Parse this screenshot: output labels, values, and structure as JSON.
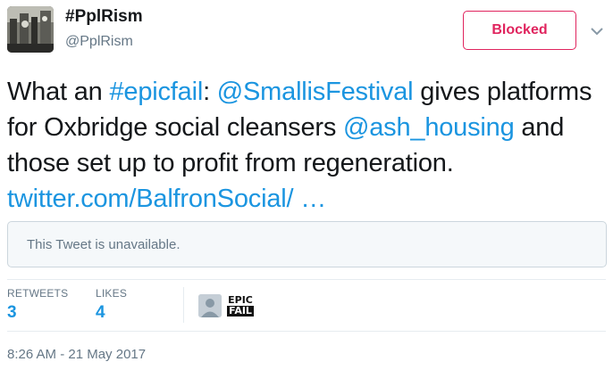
{
  "tweet": {
    "author": {
      "display_name": "#PplRism",
      "handle": "@PplRism",
      "avatar_icon": "user-avatar-photo"
    },
    "follow_button": {
      "label": "Blocked",
      "color": "#e0245e"
    },
    "more_icon": "chevron-down-icon",
    "text_segments": [
      {
        "text": "What an ",
        "type": "text"
      },
      {
        "text": "#epicfail",
        "type": "hashtag"
      },
      {
        "text": ": ",
        "type": "text"
      },
      {
        "text": "@SmallisFestival",
        "type": "mention"
      },
      {
        "text": " gives platforms for Oxbridge social cleansers ",
        "type": "text"
      },
      {
        "text": "@ash_housing",
        "type": "mention"
      },
      {
        "text": " and those set up to profit from regeneration. ",
        "type": "text"
      },
      {
        "text": "twitter.com/BalfronSocial/ …",
        "type": "link"
      }
    ],
    "quoted_tweet": {
      "message": "This Tweet is unavailable."
    },
    "stats": {
      "retweets": {
        "label": "RETWEETS",
        "value": "3"
      },
      "likes": {
        "label": "LIKES",
        "value": "4"
      }
    },
    "likers": [
      {
        "avatar_icon": "default-avatar-icon"
      },
      {
        "avatar_icon": "epic-fail-badge-icon",
        "badge_lines": [
          "EPIC",
          "FAIL"
        ]
      }
    ],
    "timestamp": "8:26 AM - 21 May 2017",
    "colors": {
      "link": "#1b95e0",
      "text": "#14171a",
      "muted": "#657786",
      "border": "#e6ecf0"
    }
  }
}
